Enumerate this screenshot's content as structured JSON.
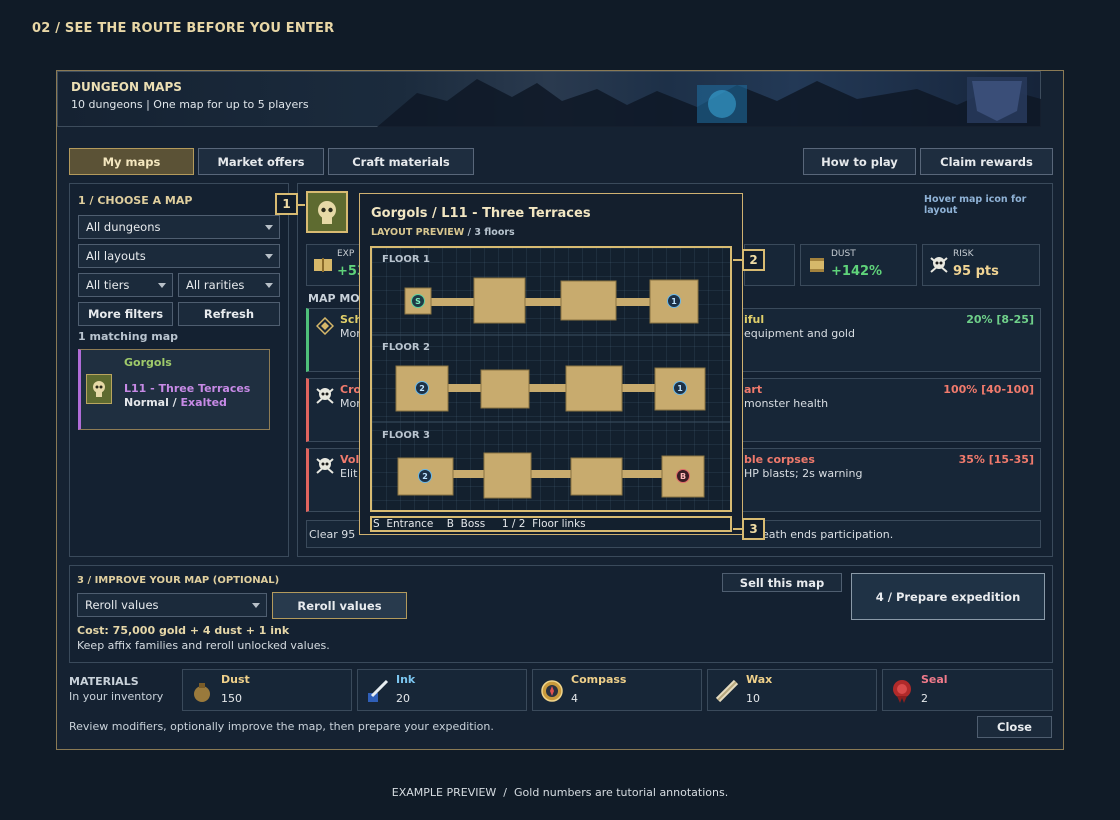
{
  "step_title": "02 / SEE THE ROUTE BEFORE YOU ENTER",
  "header": {
    "title": "DUNGEON MAPS",
    "subtitle": "10 dungeons | One map for up to 5 players"
  },
  "tabs": [
    "My maps",
    "Market offers",
    "Craft materials"
  ],
  "active_tab": "My maps",
  "top_actions": [
    "How to play",
    "Claim rewards"
  ],
  "choose": {
    "title": "1 / CHOOSE A MAP",
    "filters": {
      "dungeon": "All dungeons",
      "layout": "All layouts",
      "tier": "All tiers",
      "rarity": "All rarities"
    },
    "more_filters": "More filters",
    "refresh": "Refresh",
    "count": "1 matching map",
    "card": {
      "dungeon": "Gorgols",
      "map": "L11 - Three Terraces",
      "difficulty": "Normal",
      "sep": " / ",
      "rarity": "Exalted"
    }
  },
  "details": {
    "hover_hint": "Hover map icon for layout",
    "stats": [
      {
        "label": "EXP",
        "value": "+53",
        "color": "#5fd37a"
      },
      {
        "label": "DUST",
        "value": "+142%",
        "color": "#5fd37a"
      },
      {
        "label": "RISK",
        "value": "95 pts",
        "color": "#f0d493"
      }
    ],
    "modifiers_title": "MAP MOD",
    "modifiers": [
      {
        "name_a": "Sch",
        "name_b": "iful",
        "desc_a": "Mor",
        "desc_b": "equipment and gold",
        "range": "20% [8-25]",
        "color": "#6fd08a"
      },
      {
        "name_a": "Cro",
        "name_b": "art",
        "desc_a": "Mor",
        "desc_b": "monster health",
        "range": "100% [40-100]",
        "color": "#f07a6c"
      },
      {
        "name_a": "Vola",
        "name_b": "ble corpses",
        "desc_a": "Elit",
        "desc_b": "HP blasts; 2s warning",
        "range": "35% [15-35]",
        "color": "#f07a6c"
      }
    ],
    "footer_a": "Clear 95",
    "footer_b": "eath ends participation."
  },
  "popup": {
    "title": "Gorgols / L11 - Three Terraces",
    "preview_label": "LAYOUT PREVIEW",
    "preview_floors": " / 3 floors",
    "floors": [
      {
        "label": "FLOOR 1",
        "start": "S",
        "end": "1"
      },
      {
        "label": "FLOOR 2",
        "start": "2",
        "end": "1"
      },
      {
        "label": "FLOOR 3",
        "start": "2",
        "end": "B"
      }
    ],
    "legend": "S  Entrance    B  Boss     1 / 2  Floor links"
  },
  "callouts": [
    "1",
    "2",
    "3"
  ],
  "improve": {
    "title": "3 / IMPROVE YOUR MAP (OPTIONAL)",
    "select": "Reroll values",
    "button": "Reroll values",
    "cost": "Cost: 75,000 gold + 4 dust + 1 ink",
    "desc": "Keep affix families and reroll unlocked values.",
    "sell": "Sell this map",
    "prepare": "4 / Prepare expedition"
  },
  "materials": {
    "title": "MATERIALS",
    "subtitle": "In your inventory",
    "items": [
      {
        "name": "Dust",
        "count": "150",
        "color": "#efd08a",
        "icon": "dust-pouch-icon"
      },
      {
        "name": "Ink",
        "count": "20",
        "color": "#7cc6f0",
        "icon": "ink-quill-icon"
      },
      {
        "name": "Compass",
        "count": "4",
        "color": "#efd08a",
        "icon": "compass-icon"
      },
      {
        "name": "Wax",
        "count": "10",
        "color": "#efd08a",
        "icon": "wax-scroll-icon"
      },
      {
        "name": "Seal",
        "count": "2",
        "color": "#f07a8a",
        "icon": "seal-icon"
      }
    ]
  },
  "bottom_hint": "Review modifiers, optionally improve the map, then prepare your expedition.",
  "close": "Close",
  "caption": "EXAMPLE PREVIEW  /  Gold numbers are tutorial annotations."
}
